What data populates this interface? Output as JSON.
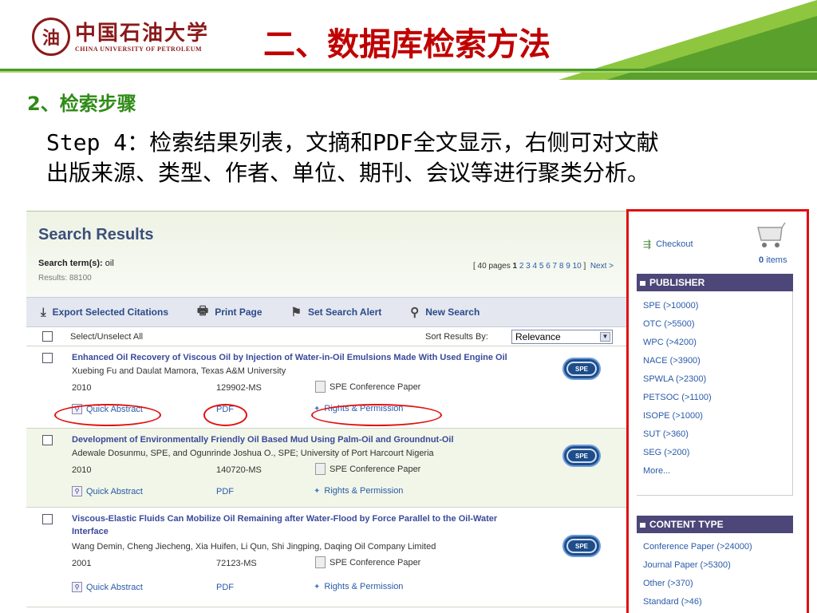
{
  "header": {
    "university_cn": "中国石油大学",
    "university_en": "CHINA UNIVERSITY OF PETROLEUM",
    "title": "二、数据库检索方法"
  },
  "step": {
    "heading": "2、检索步骤",
    "line1": "Step 4：检索结果列表，文摘和PDF全文显示，右侧可对文献",
    "line2": "出版来源、类型、作者、单位、期刊、会议等进行聚类分析。"
  },
  "search": {
    "title": "Search Results",
    "term_label": "Search term(s):",
    "term": "oil",
    "results": "Results: 88100",
    "pager": {
      "prefix": "[ 40 pages",
      "current": "1",
      "pages": "2 3 4 5 6 7 8 9 10",
      "suffix": "]",
      "next": "Next >"
    },
    "toolbar": {
      "export": "Export Selected Citations",
      "print": "Print Page",
      "alert": "Set Search Alert",
      "new": "New Search"
    },
    "select_all": "Select/Unselect All",
    "sort_label": "Sort Results By:",
    "sort_value": "Relevance",
    "items": [
      {
        "title": "Enhanced Oil Recovery of Viscous Oil by Injection of Water-in-Oil Emulsions Made With Used Engine Oil",
        "authors": "Xuebing Fu and Daulat Mamora, Texas A&M University",
        "year": "2010",
        "number": "129902-MS",
        "type": "SPE Conference Paper",
        "abstract": "Quick Abstract",
        "pdf": "PDF",
        "rights": "Rights & Permission",
        "logo": "SPE"
      },
      {
        "title": "Development of Environmentally Friendly Oil Based Mud Using Palm-Oil and Groundnut-Oil",
        "authors": "Adewale Dosunmu, SPE, and Ogunrinde Joshua O., SPE; University of Port Harcourt Nigeria",
        "year": "2010",
        "number": "140720-MS",
        "type": "SPE Conference Paper",
        "abstract": "Quick Abstract",
        "pdf": "PDF",
        "rights": "Rights & Permission",
        "logo": "SPE"
      },
      {
        "title": "Viscous-Elastic Fluids Can Mobilize Oil Remaining after Water-Flood by Force Parallel to the Oil-Water Interface",
        "authors": "Wang Demin, Cheng Jiecheng, Xia Huifen, Li Qun, Shi Jingping, Daqing Oil Company Limited",
        "year": "2001",
        "number": "72123-MS",
        "type": "SPE Conference Paper",
        "abstract": "Quick Abstract",
        "pdf": "PDF",
        "rights": "Rights & Permission",
        "logo": "SPE"
      }
    ]
  },
  "sidebar": {
    "checkout": "Checkout",
    "cart_count": "0",
    "cart_unit": "items",
    "publisher_heading": "PUBLISHER",
    "publishers": [
      "SPE (>10000)",
      "OTC (>5500)",
      "WPC (>4200)",
      "NACE (>3900)",
      "SPWLA (>2300)",
      "PETSOC (>1100)",
      "ISOPE (>1000)",
      "SUT (>360)",
      "SEG (>200)",
      "More..."
    ],
    "content_heading": "CONTENT TYPE",
    "content_types": [
      "Conference Paper (>24000)",
      "Journal Paper (>5300)",
      "Other (>370)",
      "Standard (>46)"
    ]
  },
  "colors": {
    "title_red": "#c00000",
    "heading_green": "#2e8b16",
    "link_blue": "#2a5aa8",
    "highlight_red": "#e01010",
    "facet_header": "#4c4778"
  }
}
